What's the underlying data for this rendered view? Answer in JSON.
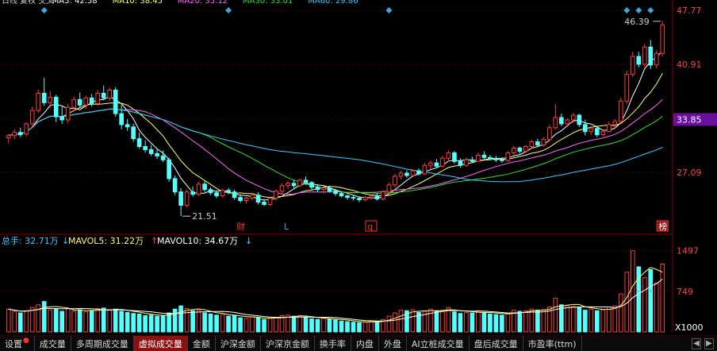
{
  "header": {
    "ma_labels": [
      {
        "text": "日线 复权 交叉",
        "color": "#d0d0d0"
      },
      {
        "text": "MA5: 42.58",
        "color": "#ffffff"
      },
      {
        "text": "MA10: 38.45",
        "color": "#ffff66"
      },
      {
        "text": "MA20: 35.12",
        "color": "#ff66ff"
      },
      {
        "text": "MA30: 33.01",
        "color": "#33dd33"
      },
      {
        "text": "MA60: 29.86",
        "color": "#33ccff"
      }
    ]
  },
  "price_axis": {
    "labels": [
      "47.77",
      "40.91",
      "33.85",
      "27.09"
    ],
    "current_price": "33.85",
    "current_price_bg": "#6a0fa0"
  },
  "annotations": {
    "high_label": "46.39",
    "low_label": "21.51",
    "markers": [
      "财",
      "L",
      "q",
      "榜"
    ]
  },
  "volume_panel": {
    "header_items": [
      {
        "text": "总手: 32.71万",
        "color": "#33ccff"
      },
      {
        "text": "MAVOL5: 31.22万",
        "color": "#ffff66"
      },
      {
        "text": "MAVOL10: 34.67万",
        "color": "#ffffff"
      }
    ],
    "axis_labels": [
      "1497",
      "749"
    ],
    "unit_label": "X1000"
  },
  "chart_data": {
    "type": "candlestick",
    "ylim": [
      19.5,
      48.5
    ],
    "candles": [
      [
        31.5,
        32.0,
        30.8,
        31.8
      ],
      [
        31.8,
        32.6,
        31.3,
        32.2
      ],
      [
        32.2,
        32.8,
        31.6,
        31.9
      ],
      [
        32.0,
        33.5,
        31.7,
        33.3
      ],
      [
        33.3,
        35.5,
        32.9,
        35.0
      ],
      [
        35.0,
        37.7,
        34.7,
        37.2
      ],
      [
        37.2,
        39.2,
        35.6,
        36.0
      ],
      [
        36.0,
        37.5,
        35.3,
        36.7
      ],
      [
        36.7,
        37.0,
        33.5,
        34.2
      ],
      [
        34.2,
        35.5,
        33.3,
        33.8
      ],
      [
        33.8,
        35.8,
        33.4,
        35.4
      ],
      [
        35.4,
        36.8,
        34.9,
        36.4
      ],
      [
        36.4,
        37.3,
        35.4,
        35.7
      ],
      [
        35.7,
        36.9,
        35.2,
        36.6
      ],
      [
        36.6,
        37.1,
        35.5,
        35.9
      ],
      [
        35.9,
        37.6,
        35.6,
        37.2
      ],
      [
        37.2,
        38.2,
        36.3,
        36.6
      ],
      [
        36.6,
        37.9,
        36.2,
        37.6
      ],
      [
        37.6,
        38.0,
        34.2,
        34.6
      ],
      [
        34.6,
        35.7,
        32.6,
        33.2
      ],
      [
        33.2,
        33.9,
        32.4,
        32.9
      ],
      [
        32.9,
        33.3,
        31.0,
        31.4
      ],
      [
        31.4,
        32.2,
        30.1,
        30.4
      ],
      [
        30.4,
        31.2,
        29.6,
        30.0
      ],
      [
        30.0,
        30.6,
        29.2,
        29.5
      ],
      [
        29.5,
        30.1,
        28.8,
        29.2
      ],
      [
        29.2,
        29.9,
        28.4,
        28.7
      ],
      [
        28.7,
        29.0,
        25.9,
        26.3
      ],
      [
        26.3,
        26.7,
        24.2,
        24.6
      ],
      [
        24.6,
        25.1,
        21.5,
        22.9
      ],
      [
        22.9,
        24.9,
        22.6,
        24.6
      ],
      [
        24.6,
        25.3,
        24.0,
        24.3
      ],
      [
        24.3,
        25.9,
        24.1,
        25.6
      ],
      [
        25.6,
        26.0,
        24.6,
        24.9
      ],
      [
        24.9,
        25.2,
        24.2,
        24.5
      ],
      [
        24.5,
        24.8,
        23.8,
        24.1
      ],
      [
        24.1,
        25.0,
        23.9,
        24.8
      ],
      [
        24.8,
        25.1,
        24.3,
        24.6
      ],
      [
        24.6,
        24.9,
        23.6,
        23.9
      ],
      [
        23.9,
        24.3,
        23.2,
        23.5
      ],
      [
        23.5,
        24.0,
        23.1,
        23.8
      ],
      [
        23.8,
        24.4,
        23.5,
        24.2
      ],
      [
        24.2,
        24.6,
        23.0,
        23.3
      ],
      [
        23.3,
        23.7,
        22.8,
        23.0
      ],
      [
        23.0,
        24.0,
        22.8,
        23.8
      ],
      [
        23.8,
        24.9,
        23.5,
        24.7
      ],
      [
        24.7,
        25.7,
        24.3,
        25.4
      ],
      [
        25.4,
        26.0,
        25.0,
        25.7
      ],
      [
        25.7,
        26.1,
        25.1,
        25.4
      ],
      [
        25.4,
        26.3,
        25.2,
        26.1
      ],
      [
        26.1,
        26.6,
        25.5,
        25.8
      ],
      [
        25.8,
        26.0,
        24.9,
        25.2
      ],
      [
        25.2,
        25.6,
        24.6,
        24.9
      ],
      [
        24.9,
        25.3,
        24.4,
        25.1
      ],
      [
        25.1,
        25.4,
        24.5,
        24.7
      ],
      [
        24.7,
        25.0,
        24.1,
        24.4
      ],
      [
        24.4,
        24.6,
        23.9,
        24.1
      ],
      [
        24.1,
        24.3,
        23.6,
        23.9
      ],
      [
        23.9,
        24.2,
        23.5,
        23.8
      ],
      [
        23.8,
        24.0,
        23.3,
        23.6
      ],
      [
        23.6,
        24.1,
        23.4,
        23.9
      ],
      [
        23.9,
        24.3,
        23.6,
        24.1
      ],
      [
        24.1,
        24.4,
        23.5,
        23.7
      ],
      [
        23.7,
        24.8,
        23.5,
        24.6
      ],
      [
        24.6,
        25.8,
        24.3,
        25.5
      ],
      [
        25.5,
        26.9,
        25.2,
        26.6
      ],
      [
        26.6,
        27.3,
        26.2,
        27.0
      ],
      [
        27.0,
        27.4,
        26.4,
        26.7
      ],
      [
        26.7,
        27.5,
        26.5,
        27.3
      ],
      [
        27.3,
        27.6,
        26.7,
        26.9
      ],
      [
        26.9,
        28.3,
        26.8,
        28.0
      ],
      [
        28.0,
        28.6,
        27.5,
        28.3
      ],
      [
        28.3,
        28.8,
        27.6,
        27.9
      ],
      [
        27.9,
        29.2,
        27.7,
        28.9
      ],
      [
        28.9,
        29.9,
        28.5,
        29.6
      ],
      [
        29.6,
        29.8,
        28.2,
        28.5
      ],
      [
        28.5,
        28.9,
        27.7,
        28.0
      ],
      [
        28.0,
        29.0,
        27.8,
        28.7
      ],
      [
        28.7,
        29.1,
        28.3,
        28.5
      ],
      [
        28.5,
        29.6,
        28.4,
        29.3
      ],
      [
        29.3,
        29.8,
        28.8,
        29.0
      ],
      [
        29.0,
        29.3,
        28.6,
        28.9
      ],
      [
        28.9,
        29.2,
        28.4,
        28.7
      ],
      [
        28.7,
        29.0,
        28.3,
        28.6
      ],
      [
        28.6,
        29.8,
        28.5,
        29.6
      ],
      [
        29.6,
        30.5,
        29.3,
        30.2
      ],
      [
        30.2,
        30.4,
        29.5,
        29.8
      ],
      [
        29.8,
        30.6,
        29.6,
        30.4
      ],
      [
        30.4,
        31.3,
        30.1,
        31.0
      ],
      [
        31.0,
        31.4,
        30.3,
        30.6
      ],
      [
        30.6,
        31.6,
        30.4,
        31.3
      ],
      [
        31.3,
        33.2,
        31.0,
        32.8
      ],
      [
        32.8,
        35.8,
        32.6,
        34.1
      ],
      [
        34.1,
        34.6,
        33.0,
        33.3
      ],
      [
        33.3,
        34.0,
        32.9,
        33.8
      ],
      [
        33.8,
        34.7,
        33.4,
        34.4
      ],
      [
        34.4,
        34.6,
        32.9,
        33.2
      ],
      [
        33.2,
        33.8,
        31.8,
        32.3
      ],
      [
        32.3,
        33.0,
        31.9,
        32.7
      ],
      [
        32.7,
        32.9,
        31.6,
        31.9
      ],
      [
        31.9,
        32.6,
        31.7,
        32.3
      ],
      [
        32.3,
        33.6,
        32.2,
        33.2
      ],
      [
        33.2,
        33.9,
        32.6,
        33.6
      ],
      [
        33.6,
        36.6,
        33.4,
        36.2
      ],
      [
        36.2,
        40.1,
        35.8,
        39.6
      ],
      [
        39.6,
        42.5,
        39.3,
        41.9
      ],
      [
        41.9,
        42.5,
        40.5,
        40.9
      ],
      [
        40.9,
        43.5,
        40.6,
        43.1
      ],
      [
        43.1,
        44.0,
        40.3,
        40.8
      ],
      [
        40.8,
        42.7,
        40.4,
        42.3
      ],
      [
        42.3,
        46.39,
        41.9,
        45.9
      ]
    ],
    "volumes": [
      420,
      380,
      350,
      390,
      450,
      500,
      560,
      410,
      420,
      380,
      430,
      380,
      410,
      370,
      390,
      430,
      440,
      400,
      420,
      380,
      360,
      340,
      330,
      300,
      310,
      290,
      300,
      350,
      420,
      480,
      430,
      390,
      400,
      350,
      330,
      310,
      320,
      290,
      300,
      260,
      250,
      280,
      260,
      230,
      250,
      270,
      300,
      310,
      290,
      300,
      270,
      240,
      230,
      250,
      240,
      220,
      200,
      190,
      180,
      170,
      180,
      200,
      190,
      230,
      290,
      350,
      400,
      390,
      410,
      360,
      380,
      420,
      390,
      400,
      450,
      370,
      340,
      360,
      350,
      390,
      360,
      330,
      320,
      310,
      350,
      400,
      380,
      390,
      420,
      400,
      410,
      460,
      620,
      500,
      480,
      470,
      460,
      400,
      420,
      390,
      410,
      460,
      480,
      700,
      1100,
      1497,
      1200,
      1000,
      1150,
      900,
      1250
    ],
    "series": [
      {
        "name": "MA5",
        "color": "#ffffff"
      },
      {
        "name": "MA10",
        "color": "#ffff66"
      },
      {
        "name": "MA20",
        "color": "#ff66ff"
      },
      {
        "name": "MA30",
        "color": "#33dd33"
      },
      {
        "name": "MA60",
        "color": "#33ccff"
      }
    ],
    "up_color": "#ff3b3b",
    "down_color": "#54ffff",
    "volume_ylim": [
      0,
      1550
    ]
  },
  "tabs": [
    {
      "label": "设置",
      "active": false,
      "dot": true
    },
    {
      "label": "成交量",
      "active": false
    },
    {
      "label": "多周期成交量",
      "active": false
    },
    {
      "label": "虚拟成交量",
      "active": true
    },
    {
      "label": "金额",
      "active": false
    },
    {
      "label": "沪深金额",
      "active": false
    },
    {
      "label": "沪深京金额",
      "active": false
    },
    {
      "label": "换手率",
      "active": false
    },
    {
      "label": "内盘",
      "active": false
    },
    {
      "label": "外盘",
      "active": false
    },
    {
      "label": "AI立桩成交量",
      "active": false
    },
    {
      "label": "盘后成交量",
      "active": false
    },
    {
      "label": "市盈率(ttm)",
      "active": false
    }
  ]
}
